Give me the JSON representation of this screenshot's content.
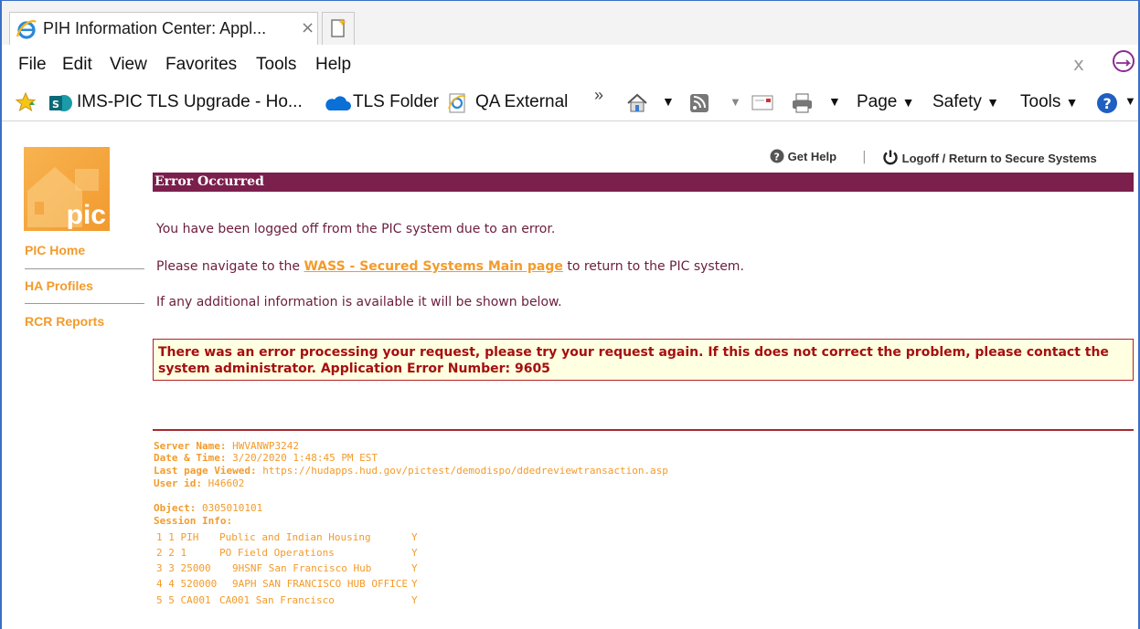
{
  "browser": {
    "tab_title": "PIH Information Center: Appl...",
    "tab_close": "×",
    "menu": [
      "File",
      "Edit",
      "View",
      "Favorites",
      "Tools",
      "Help"
    ],
    "window_close": "x",
    "favorites": [
      {
        "label": "IMS-PIC TLS Upgrade - Ho...",
        "icon": "sharepoint-icon"
      },
      {
        "label": "TLS Folder",
        "icon": "onedrive-cloud-icon"
      },
      {
        "label": "QA External",
        "icon": "ie-page-icon"
      }
    ],
    "overflow": "»",
    "command": {
      "page": "Page",
      "safety": "Safety",
      "tools": "Tools"
    }
  },
  "app": {
    "logo_text": "pic",
    "nav": [
      "PIC Home",
      "HA Profiles",
      "RCR Reports"
    ],
    "get_help": "Get Help",
    "separator": "|",
    "logoff": "Logoff / Return to Secure Systems",
    "error_header": "Error Occurred",
    "msg1": "You have been logged off from the PIC system due to an error.",
    "msg2_pre": "Please navigate to the ",
    "msg2_link": "WASS - Secured Systems Main page",
    "msg2_post": " to return to the PIC system.",
    "msg3": "If any additional information is available it will be shown below.",
    "error_box": "There was an error processing your request, please try your request again. If this does not correct the problem, please contact the system administrator. Application Error Number: 9605"
  },
  "debug": {
    "server_label": "Server Name:",
    "server_value": " HWVANWP3242",
    "datetime_label": "Date & Time:",
    "datetime_value": " 3/20/2020 1:48:45 PM EST",
    "lastpage_label": "Last page Viewed:",
    "lastpage_value": " https://hudapps.hud.gov/pictest/demodispo/ddedreviewtransaction.asp",
    "userid_label": "User id:",
    "userid_value": " H46602",
    "object_label": "Object:",
    "object_value": " 0305010101",
    "session_label": "Session Info:",
    "session_rows": [
      {
        "code": "1 1 PIH",
        "desc": "Public and Indian Housing",
        "flag": "Y"
      },
      {
        "code": "2 2 1",
        "desc": "PO Field Operations",
        "flag": "Y"
      },
      {
        "code": "3 3 25000",
        "desc": "9HSNF San Francisco Hub",
        "flag": "Y"
      },
      {
        "code": "4 4 520000",
        "desc": "9APH SAN FRANCISCO HUB OFFICE",
        "flag": "Y"
      },
      {
        "code": "5 5 CA001",
        "desc": "CA001 San Francisco",
        "flag": "Y"
      }
    ]
  }
}
